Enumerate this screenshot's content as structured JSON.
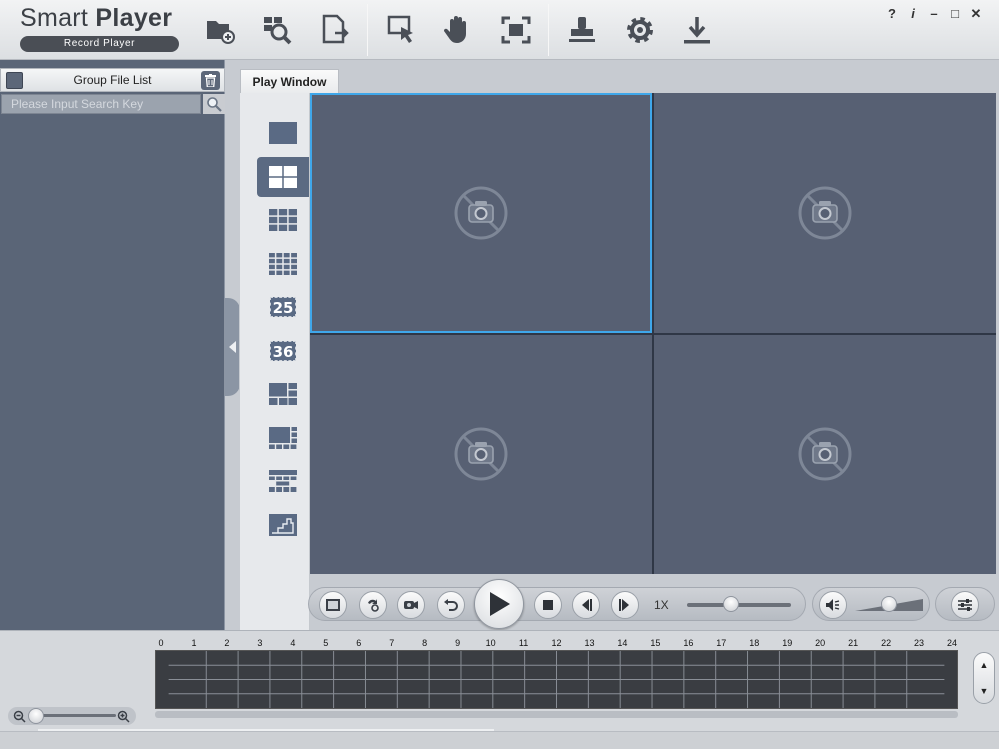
{
  "app": {
    "title_light": "Smart ",
    "title_bold": "Player",
    "subtitle": "Record Player"
  },
  "toolbar": {
    "buttons": [
      {
        "name": "open-folder-icon"
      },
      {
        "name": "search-file-icon"
      },
      {
        "name": "export-file-icon"
      },
      {
        "name": "select-cursor-icon"
      },
      {
        "name": "hand-icon"
      },
      {
        "name": "fullscreen-icon"
      },
      {
        "name": "stamp-icon"
      },
      {
        "name": "gear-icon"
      },
      {
        "name": "download-icon"
      }
    ]
  },
  "window_controls": {
    "help": "?",
    "info": "i",
    "minimize": "–",
    "maximize": "□",
    "close": "✕"
  },
  "left_panel": {
    "title": "Group File List",
    "search_placeholder": "Please Input Search Key"
  },
  "tabs": {
    "play_window": "Play Window"
  },
  "layouts": {
    "selected_index": 1,
    "items": [
      {
        "name": "layout-1-icon",
        "label": ""
      },
      {
        "name": "layout-4-icon",
        "label": ""
      },
      {
        "name": "layout-9-icon",
        "label": ""
      },
      {
        "name": "layout-16-icon",
        "label": ""
      },
      {
        "name": "layout-25-icon",
        "label": "25"
      },
      {
        "name": "layout-36-icon",
        "label": "36"
      },
      {
        "name": "layout-6-icon",
        "label": ""
      },
      {
        "name": "layout-8-icon",
        "label": ""
      },
      {
        "name": "layout-13-icon",
        "label": ""
      },
      {
        "name": "layout-custom-icon",
        "label": ""
      }
    ]
  },
  "video": {
    "selected_cell": 0,
    "cells": 4
  },
  "controls": {
    "speed": "1X",
    "speed_position": 0.42,
    "volume_position": 0.5
  },
  "timeline": {
    "hours": [
      "0",
      "1",
      "2",
      "3",
      "4",
      "5",
      "6",
      "7",
      "8",
      "9",
      "10",
      "11",
      "12",
      "13",
      "14",
      "15",
      "16",
      "17",
      "18",
      "19",
      "20",
      "21",
      "22",
      "23",
      "24"
    ],
    "rows": 4,
    "up": "▲",
    "down": "▼"
  },
  "colors": {
    "accent_selected": "#3fa7ea",
    "video_bg": "#576073",
    "panel_bg": "#5a6577"
  }
}
